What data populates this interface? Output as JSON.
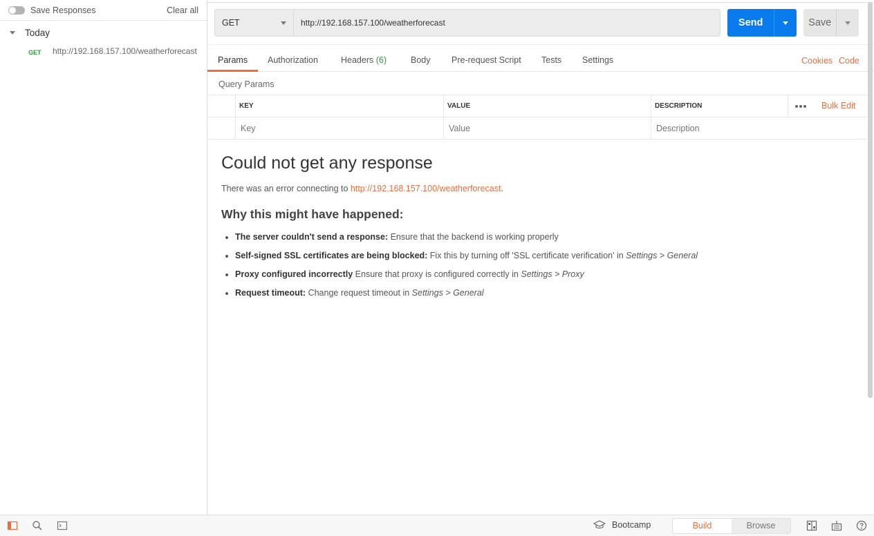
{
  "sidebar": {
    "save_responses_label": "Save Responses",
    "clear_all_label": "Clear all",
    "group_label": "Today",
    "history": [
      {
        "method": "GET",
        "url": "http://192.168.157.100/weatherforecast"
      }
    ]
  },
  "request": {
    "method": "GET",
    "url": "http://192.168.157.100/weatherforecast",
    "send_label": "Send",
    "save_label": "Save"
  },
  "tabs": {
    "params": "Params",
    "authorization": "Authorization",
    "headers": "Headers",
    "headers_count": "(6)",
    "body": "Body",
    "prerequest": "Pre-request Script",
    "tests": "Tests",
    "settings": "Settings",
    "cookies": "Cookies",
    "code": "Code"
  },
  "params": {
    "title": "Query Params",
    "columns": {
      "key": "KEY",
      "value": "VALUE",
      "description": "DESCRIPTION"
    },
    "bulk_edit": "Bulk Edit",
    "placeholders": {
      "key": "Key",
      "value": "Value",
      "description": "Description"
    }
  },
  "response": {
    "title": "Could not get any response",
    "error_prefix": "There was an error connecting to ",
    "error_url": "http://192.168.157.100/weatherforecast",
    "error_suffix": ".",
    "why_title": "Why this might have happened:",
    "reasons": [
      {
        "bold": "The server couldn't send a response:",
        "text": " Ensure that the backend is working properly",
        "em": ""
      },
      {
        "bold": "Self-signed SSL certificates are being blocked:",
        "text": " Fix this by turning off 'SSL certificate verification' in ",
        "em": "Settings > General"
      },
      {
        "bold": "Proxy configured incorrectly",
        "text": " Ensure that proxy is configured correctly in ",
        "em": "Settings > Proxy"
      },
      {
        "bold": "Request timeout:",
        "text": " Change request timeout in ",
        "em": "Settings > General"
      }
    ]
  },
  "footer": {
    "bootcamp": "Bootcamp",
    "build": "Build",
    "browse": "Browse"
  },
  "colors": {
    "accent": "#f26b3a",
    "send": "#097bed",
    "get_method": "#2a9d3b"
  },
  "icons": [
    "sidebar-toggle-icon",
    "search-icon",
    "console-icon",
    "bootcamp-icon",
    "two-pane-icon",
    "keyboard-shortcuts-icon",
    "help-icon"
  ]
}
